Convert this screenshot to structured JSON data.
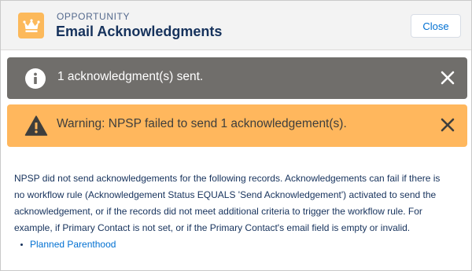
{
  "header": {
    "object_type": "OPPORTUNITY",
    "title": "Email Acknowledgments",
    "icon": "crown-icon",
    "close_label": "Close"
  },
  "toasts": [
    {
      "type": "info",
      "icon": "info-icon",
      "message": "1 acknowledgment(s) sent.",
      "color": "#706e6b"
    },
    {
      "type": "warning",
      "icon": "warning-icon",
      "message": "Warning: NPSP failed to send 1 acknowledgement(s).",
      "color": "#ffb75d"
    }
  ],
  "body": {
    "lines": [
      "NPSP did not send acknowledgements for the following records. Acknowledgements can fail if there is",
      "no workflow rule (Acknowledgement Status EQUALS 'Send Acknowledgement') activated to send the",
      "acknowledgement, or if the records did not meet additional criteria to trigger the workflow rule. For",
      "example, if Primary Contact is not set, or if the Primary Contact's email field is empty or invalid."
    ],
    "records": [
      "Planned Parenthood"
    ]
  },
  "colors": {
    "accent": "#0070d2",
    "header_bg": "#f3f3f3",
    "object_icon": "#fcb95b"
  }
}
